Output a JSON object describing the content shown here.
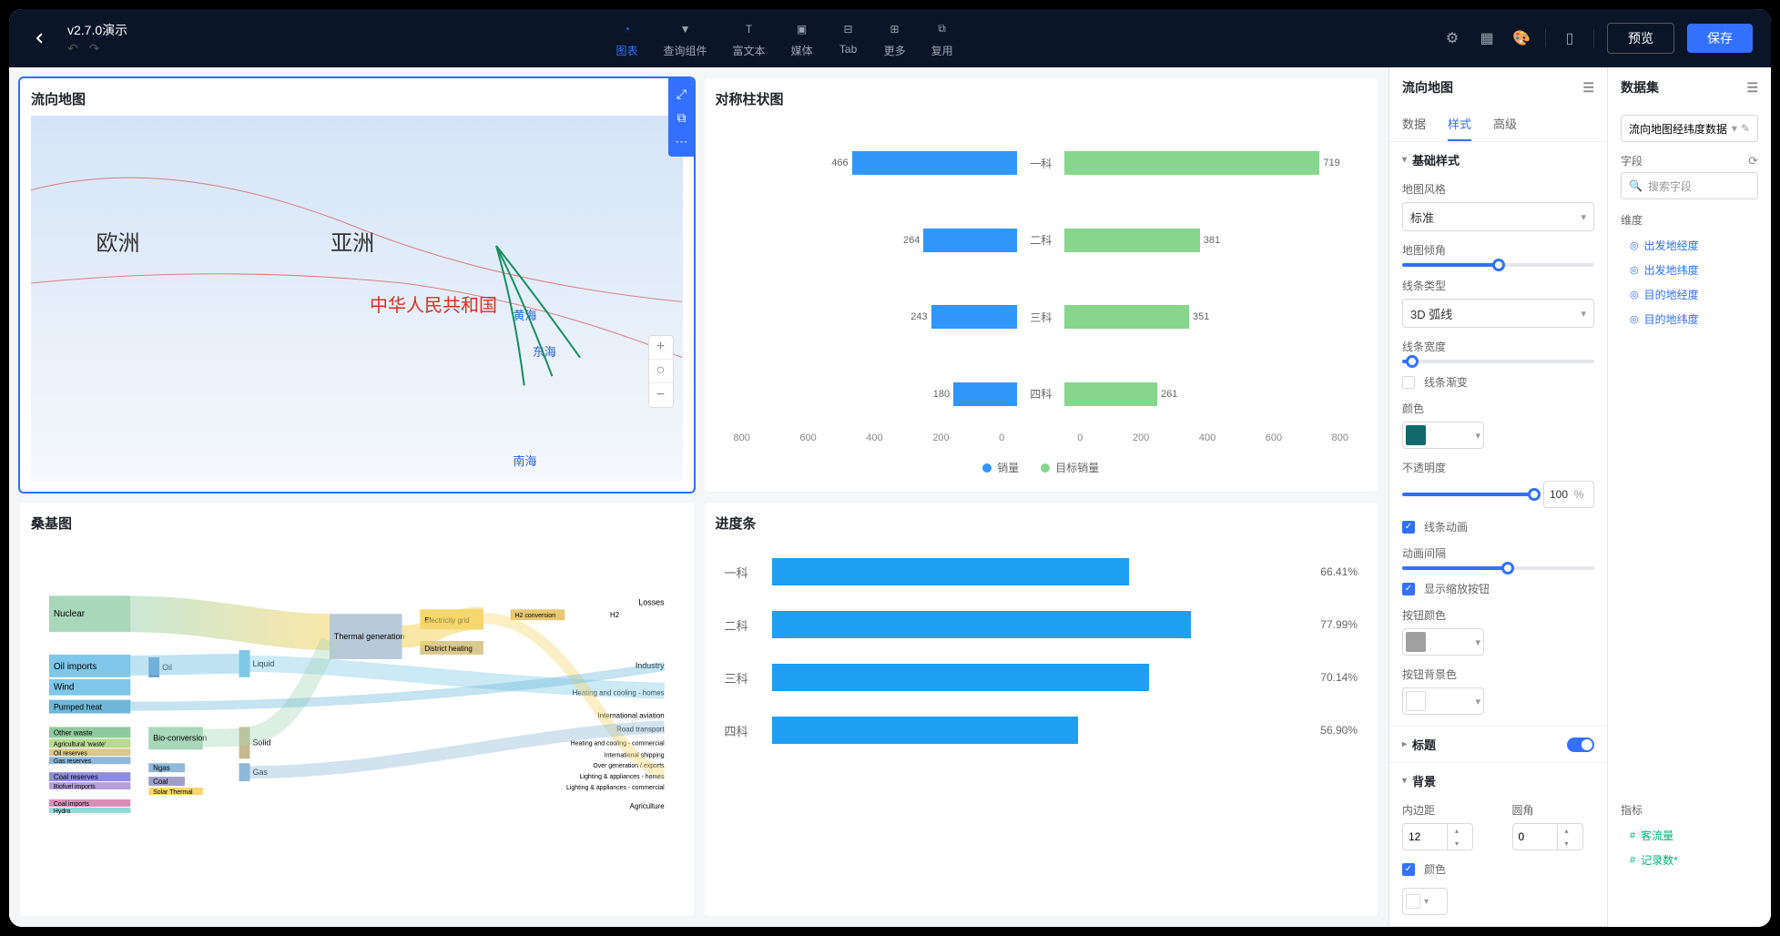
{
  "header": {
    "title": "v2.7.0演示",
    "tools": [
      {
        "id": "chart",
        "label": "图表",
        "active": true
      },
      {
        "id": "query",
        "label": "查询组件"
      },
      {
        "id": "text",
        "label": "富文本"
      },
      {
        "id": "media",
        "label": "媒体"
      },
      {
        "id": "tab",
        "label": "Tab"
      },
      {
        "id": "more",
        "label": "更多"
      },
      {
        "id": "reuse",
        "label": "复用"
      }
    ],
    "preview": "预览",
    "save": "保存"
  },
  "panels": {
    "map": {
      "title": "流向地图",
      "labels": {
        "eu": "欧洲",
        "asia": "亚洲",
        "cn": "中华人民共和国",
        "yellow_sea": "黄海",
        "east_sea": "东海",
        "south_sea": "南海"
      }
    },
    "bar": {
      "title": "对称柱状图"
    },
    "sankey": {
      "title": "桑基图"
    },
    "progress": {
      "title": "进度条"
    }
  },
  "chart_data": [
    {
      "type": "bar",
      "title": "对称柱状图",
      "categories": [
        "一科",
        "二科",
        "三科",
        "四科"
      ],
      "series": [
        {
          "name": "销量",
          "values": [
            466,
            264,
            243,
            180
          ],
          "color": "#3196fa"
        },
        {
          "name": "目标销量",
          "values": [
            719,
            381,
            351,
            261
          ],
          "color": "#87d68d"
        }
      ],
      "axis_ticks_left": [
        0,
        200,
        400,
        600,
        800
      ],
      "axis_ticks_right": [
        0,
        200,
        400,
        600,
        800
      ],
      "axis_max": 800
    },
    {
      "type": "bar",
      "title": "进度条",
      "categories": [
        "一科",
        "二科",
        "三科",
        "四科"
      ],
      "values": [
        66.41,
        77.99,
        70.14,
        56.9
      ],
      "value_suffix": "%",
      "ylim": [
        0,
        100
      ]
    },
    {
      "type": "sankey",
      "title": "桑基图",
      "nodes_left": [
        "Nuclear",
        "Oil imports",
        "Wind",
        "Pumped heat",
        "Other waste",
        "Agricultural 'waste'",
        "Oil reserves",
        "Gas reserves",
        "Coal reserves",
        "Biofuel imports",
        "Coal imports",
        "Hydro"
      ],
      "nodes_mid": [
        "Oil",
        "Bio-conversion",
        "Ngas",
        "Coal",
        "Solar Thermal",
        "Thermal generation",
        "Liquid",
        "Solid",
        "Gas",
        "Electricity grid",
        "District heating"
      ],
      "nodes_right": [
        "H2 conversion",
        "H2",
        "Losses",
        "Industry",
        "Heating and cooling - homes",
        "International aviation",
        "Road transport",
        "Heating and cooling - commercial",
        "International shipping",
        "Over generation / exports",
        "Lighting & appliances - homes",
        "Lighting & appliances - commercial",
        "Agriculture"
      ]
    }
  ],
  "props_panel": {
    "title": "流向地图",
    "tabs": {
      "data": "数据",
      "style": "样式",
      "advanced": "高级",
      "active": "style"
    },
    "sections": {
      "basic": {
        "title": "基础样式",
        "map_style": {
          "label": "地图风格",
          "value": "标准"
        },
        "map_tilt": {
          "label": "地图倾角",
          "value": 80
        },
        "line_type": {
          "label": "线条类型",
          "value": "3D 弧线"
        },
        "line_width": {
          "label": "线条宽度",
          "value": 5
        },
        "line_gradient": {
          "label": "线条渐变",
          "checked": false
        },
        "color": {
          "label": "颜色",
          "value": "#0f6b6b"
        },
        "opacity": {
          "label": "不透明度",
          "value": 100,
          "unit": "%"
        },
        "line_anim": {
          "label": "线条动画",
          "checked": true
        },
        "anim_interval": {
          "label": "动画间隔",
          "value": 30
        },
        "show_zoom": {
          "label": "显示缩放按钮",
          "checked": true
        },
        "btn_color": {
          "label": "按钮颜色",
          "value": "#a0a0a0"
        },
        "btn_bg": {
          "label": "按钮背景色",
          "value": "#ffffff"
        }
      },
      "title_sec": {
        "title": "标题",
        "on": true
      },
      "bg": {
        "title": "背景",
        "padding": {
          "label": "内边距",
          "value": 12
        },
        "radius": {
          "label": "圆角",
          "value": 0
        },
        "bg_color": {
          "label": "颜色",
          "checked": true
        }
      }
    }
  },
  "dataset_panel": {
    "title": "数据集",
    "selected": "流向地图经纬度数据",
    "fields_label": "字段",
    "search_placeholder": "搜索字段",
    "dim_label": "维度",
    "dims": [
      "出发地经度",
      "出发地纬度",
      "目的地经度",
      "目的地纬度"
    ],
    "metric_label": "指标",
    "metrics": [
      "客流量",
      "记录数*"
    ]
  }
}
